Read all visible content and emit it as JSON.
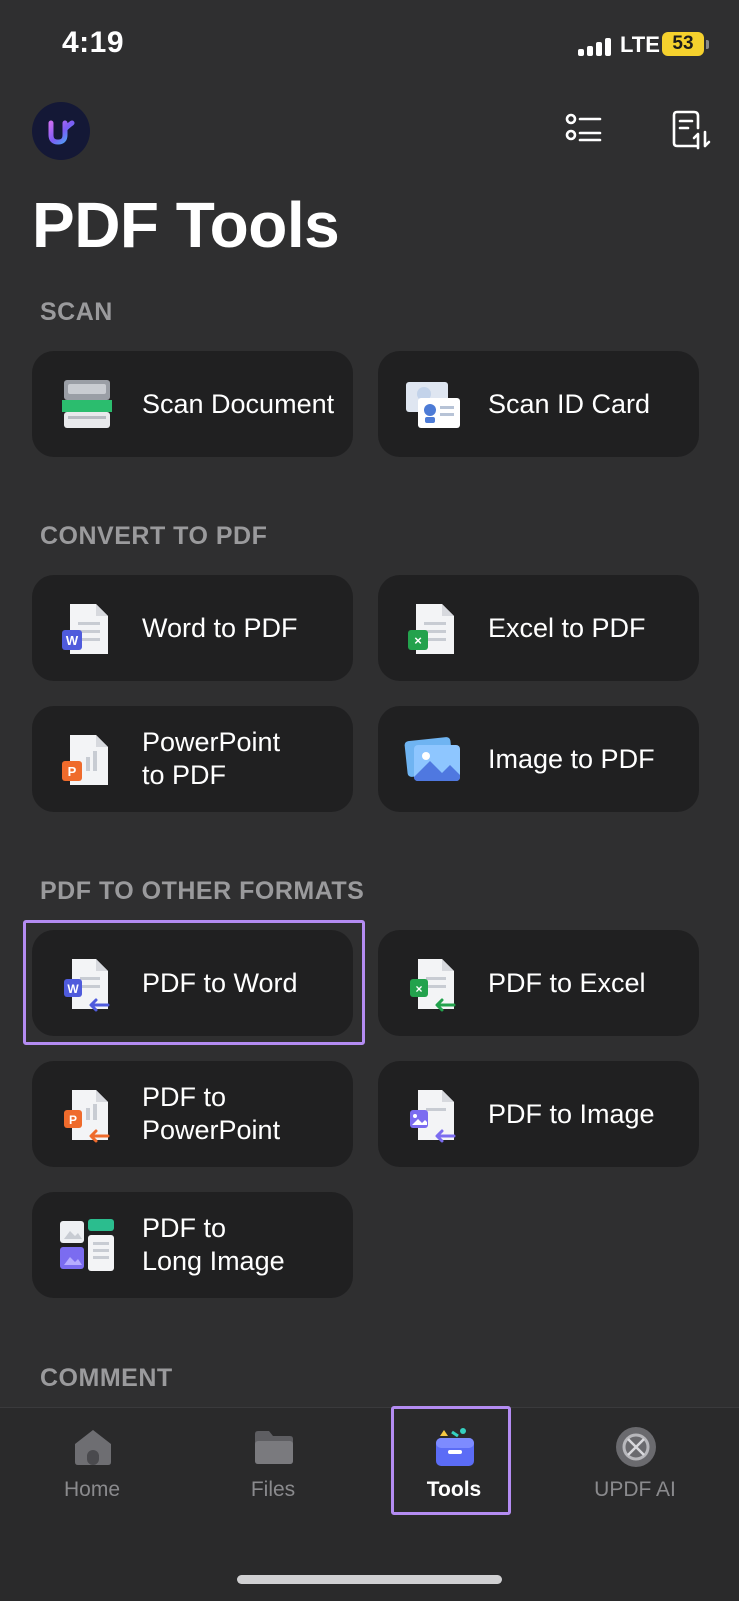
{
  "status_bar": {
    "time": "4:19",
    "network": "LTE",
    "battery": "53"
  },
  "header": {
    "title": "PDF Tools"
  },
  "sections": [
    {
      "label": "SCAN",
      "tools": [
        {
          "label": "Scan Document",
          "icon": "scanner-icon"
        },
        {
          "label": "Scan ID Card",
          "icon": "id-card-icon"
        }
      ]
    },
    {
      "label": "CONVERT TO PDF",
      "tools": [
        {
          "label": "Word to PDF",
          "icon": "word-doc-icon"
        },
        {
          "label": "Excel to PDF",
          "icon": "excel-doc-icon"
        },
        {
          "label": "PowerPoint\nto PDF",
          "icon": "powerpoint-doc-icon"
        },
        {
          "label": "Image to PDF",
          "icon": "image-doc-icon"
        }
      ]
    },
    {
      "label": "PDF TO OTHER FORMATS",
      "tools": [
        {
          "label": "PDF to Word",
          "icon": "pdf-to-word-icon"
        },
        {
          "label": "PDF to Excel",
          "icon": "pdf-to-excel-icon"
        },
        {
          "label": "PDF to\nPowerPoint",
          "icon": "pdf-to-powerpoint-icon"
        },
        {
          "label": "PDF to Image",
          "icon": "pdf-to-image-icon"
        },
        {
          "label": "PDF to\nLong Image",
          "icon": "pdf-to-long-image-icon"
        }
      ]
    },
    {
      "label": "COMMENT",
      "tools": []
    }
  ],
  "tab_bar": {
    "tabs": [
      {
        "label": "Home",
        "icon": "home-icon"
      },
      {
        "label": "Files",
        "icon": "folder-icon"
      },
      {
        "label": "Tools",
        "icon": "toolbox-icon",
        "active": true
      },
      {
        "label": "UPDF AI",
        "icon": "ai-icon"
      }
    ]
  },
  "colors": {
    "background": "#2f2f30",
    "card": "#202021",
    "highlight": "#b48cf2",
    "section_label": "#9a9a9c"
  }
}
